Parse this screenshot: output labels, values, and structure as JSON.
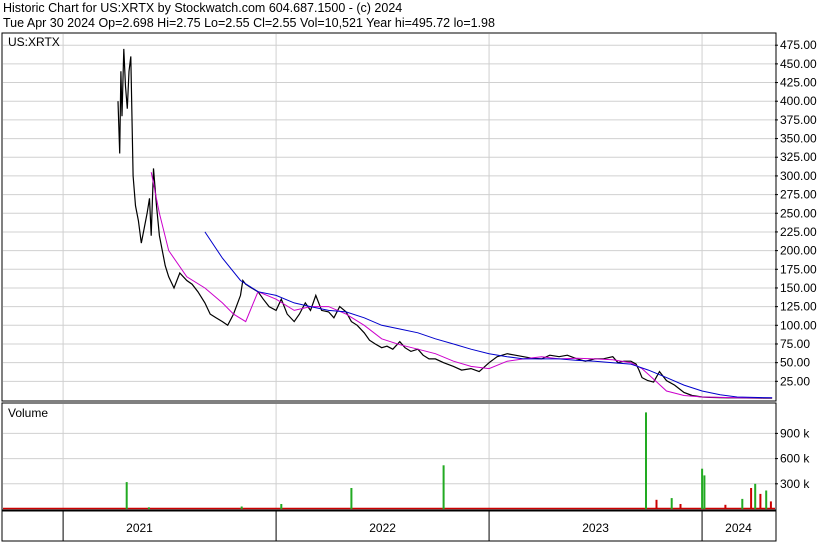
{
  "header": {
    "line1": "Historic Chart for US:XRTX by Stockwatch.com 604.687.1500 - (c) 2024",
    "line2": "Tue Apr 30 2024  Op=2.698  Hi=2.75  Lo=2.55  Cl=2.55  Vol=10,521  Year hi=495.72  lo=1.98"
  },
  "colors": {
    "price_line": "#000000",
    "ma_short": "#cc00cc",
    "ma_long": "#0000cc",
    "vol_up": "#22aa22",
    "vol_down": "#cc0000",
    "grid": "#d0d0d0",
    "border": "#000000"
  },
  "chart_data": [
    {
      "type": "line",
      "title": "US:XRTX",
      "xlabel": "",
      "ylabel": "",
      "ylim": [
        0,
        490
      ],
      "y_ticks": [
        475,
        450,
        425,
        400,
        375,
        350,
        325,
        300,
        275,
        250,
        225,
        200,
        175,
        150,
        125,
        100,
        75,
        50,
        25
      ],
      "y_tick_labels": [
        "475.00",
        "450.00",
        "425.00",
        "400.00",
        "375.00",
        "350.00",
        "325.00",
        "300.00",
        "275.00",
        "250.00",
        "225.00",
        "200.00",
        "175.00",
        "150.00",
        "125.00",
        "100.00",
        "75.00",
        "50.00",
        "25.00"
      ],
      "x_ticks": [
        "2021",
        "2022",
        "2023",
        "2024"
      ],
      "x_tick_dates": [
        "2021-01-01",
        "2022-01-01",
        "2023-01-01",
        "2024-01-01"
      ],
      "xlim": [
        "2020-09-20",
        "2024-05-05"
      ],
      "grid": true,
      "series": [
        {
          "style": "price",
          "x": [
            "2021-04-05",
            "2021-04-08",
            "2021-04-10",
            "2021-04-12",
            "2021-04-15",
            "2021-04-18",
            "2021-04-21",
            "2021-04-24",
            "2021-04-27",
            "2021-05-01",
            "2021-05-05",
            "2021-05-10",
            "2021-05-15",
            "2021-05-20",
            "2021-05-25",
            "2021-05-29",
            "2021-06-01",
            "2021-06-05",
            "2021-06-10",
            "2021-06-15",
            "2021-06-20",
            "2021-06-25",
            "2021-07-01",
            "2021-07-10",
            "2021-07-20",
            "2021-08-01",
            "2021-08-10",
            "2021-08-20",
            "2021-09-01",
            "2021-09-10",
            "2021-09-20",
            "2021-10-01",
            "2021-10-10",
            "2021-10-20",
            "2021-11-01",
            "2021-11-05",
            "2021-11-10",
            "2021-11-20",
            "2021-12-01",
            "2021-12-10",
            "2021-12-20",
            "2022-01-01",
            "2022-01-10",
            "2022-01-20",
            "2022-02-01",
            "2022-02-10",
            "2022-02-20",
            "2022-03-01",
            "2022-03-10",
            "2022-03-20",
            "2022-04-01",
            "2022-04-10",
            "2022-04-20",
            "2022-05-01",
            "2022-05-10",
            "2022-05-20",
            "2022-06-01",
            "2022-06-10",
            "2022-06-20",
            "2022-07-01",
            "2022-07-10",
            "2022-07-20",
            "2022-08-01",
            "2022-08-10",
            "2022-08-20",
            "2022-09-01",
            "2022-09-10",
            "2022-09-20",
            "2022-10-01",
            "2022-10-15",
            "2022-11-01",
            "2022-11-15",
            "2022-12-01",
            "2022-12-15",
            "2023-01-01",
            "2023-01-15",
            "2023-02-01",
            "2023-02-15",
            "2023-03-01",
            "2023-03-15",
            "2023-04-01",
            "2023-04-15",
            "2023-05-01",
            "2023-05-15",
            "2023-06-01",
            "2023-06-15",
            "2023-07-01",
            "2023-07-15",
            "2023-08-01",
            "2023-08-10",
            "2023-08-20",
            "2023-09-01",
            "2023-09-10",
            "2023-09-15",
            "2023-09-20",
            "2023-09-25",
            "2023-09-30",
            "2023-10-10",
            "2023-10-20",
            "2023-11-01",
            "2023-11-15",
            "2023-12-01",
            "2023-12-15",
            "2024-01-01",
            "2024-01-15",
            "2024-02-01",
            "2024-02-15",
            "2024-03-01",
            "2024-03-15",
            "2024-04-01",
            "2024-04-15",
            "2024-04-30"
          ],
          "values": [
            400,
            330,
            440,
            380,
            470,
            420,
            390,
            440,
            460,
            300,
            260,
            240,
            210,
            230,
            250,
            270,
            220,
            310,
            260,
            220,
            200,
            180,
            165,
            150,
            170,
            160,
            155,
            145,
            130,
            115,
            110,
            105,
            100,
            115,
            140,
            160,
            155,
            150,
            145,
            135,
            125,
            120,
            135,
            115,
            105,
            115,
            130,
            120,
            140,
            120,
            118,
            110,
            125,
            118,
            105,
            100,
            90,
            80,
            75,
            70,
            72,
            68,
            78,
            70,
            65,
            68,
            60,
            55,
            55,
            50,
            45,
            40,
            42,
            38,
            50,
            58,
            62,
            60,
            58,
            56,
            55,
            60,
            58,
            60,
            55,
            52,
            55,
            55,
            58,
            50,
            52,
            52,
            48,
            40,
            30,
            28,
            26,
            24,
            38,
            26,
            20,
            10,
            6,
            4,
            3.5,
            3.2,
            3.0,
            2.9,
            2.8,
            2.7,
            2.6,
            2.55
          ]
        },
        {
          "style": "ma_short",
          "x": [
            "2021-06-01",
            "2021-06-15",
            "2021-07-01",
            "2021-08-01",
            "2021-09-01",
            "2021-10-01",
            "2021-10-20",
            "2021-11-10",
            "2021-12-01",
            "2022-01-01",
            "2022-02-01",
            "2022-03-01",
            "2022-04-01",
            "2022-05-01",
            "2022-06-01",
            "2022-07-01",
            "2022-08-01",
            "2022-09-01",
            "2022-10-01",
            "2022-11-01",
            "2022-12-01",
            "2023-01-01",
            "2023-02-01",
            "2023-03-01",
            "2023-04-01",
            "2023-05-01",
            "2023-06-01",
            "2023-07-01",
            "2023-08-01",
            "2023-09-01",
            "2023-09-20",
            "2023-10-10",
            "2023-11-01",
            "2023-12-01",
            "2024-01-01",
            "2024-02-01",
            "2024-03-01",
            "2024-04-30"
          ],
          "values": [
            305,
            250,
            200,
            165,
            150,
            130,
            115,
            105,
            145,
            135,
            120,
            125,
            125,
            115,
            100,
            82,
            74,
            68,
            62,
            52,
            45,
            42,
            52,
            55,
            58,
            55,
            56,
            55,
            54,
            50,
            42,
            28,
            12,
            6,
            4,
            3.5,
            3,
            2.8
          ]
        },
        {
          "style": "ma_long",
          "x": [
            "2021-09-01",
            "2021-10-01",
            "2021-11-01",
            "2021-12-01",
            "2022-01-01",
            "2022-02-01",
            "2022-03-01",
            "2022-04-01",
            "2022-05-01",
            "2022-06-01",
            "2022-07-01",
            "2022-08-01",
            "2022-09-01",
            "2022-10-01",
            "2022-11-01",
            "2022-12-01",
            "2023-01-01",
            "2023-02-01",
            "2023-03-01",
            "2023-04-01",
            "2023-05-01",
            "2023-06-01",
            "2023-07-01",
            "2023-08-01",
            "2023-09-01",
            "2023-10-01",
            "2023-11-01",
            "2023-12-01",
            "2024-01-01",
            "2024-02-01",
            "2024-03-01",
            "2024-04-30"
          ],
          "values": [
            225,
            190,
            160,
            145,
            140,
            130,
            125,
            120,
            118,
            110,
            100,
            95,
            90,
            82,
            75,
            68,
            62,
            58,
            55,
            55,
            55,
            53,
            52,
            50,
            48,
            40,
            30,
            20,
            12,
            7,
            4,
            3
          ]
        }
      ]
    },
    {
      "type": "bar",
      "title": "Volume",
      "ylim": [
        0,
        1250000
      ],
      "y_ticks": [
        900000,
        600000,
        300000
      ],
      "y_tick_labels": [
        "900 k",
        "600 k",
        "300 k"
      ],
      "x": [
        "2021-04-20",
        "2021-05-28",
        "2021-11-03",
        "2022-01-10",
        "2022-05-10",
        "2022-10-15",
        "2023-09-27",
        "2023-10-15",
        "2023-11-10",
        "2023-11-25",
        "2024-01-01",
        "2024-01-05",
        "2024-02-10",
        "2024-03-10",
        "2024-03-25",
        "2024-04-01",
        "2024-04-10",
        "2024-04-20",
        "2024-04-28"
      ],
      "values": [
        320000,
        20000,
        30000,
        60000,
        250000,
        520000,
        1150000,
        110000,
        130000,
        60000,
        480000,
        400000,
        50000,
        120000,
        250000,
        300000,
        180000,
        220000,
        90000
      ],
      "colors": [
        "#22aa22",
        "#22aa22",
        "#22aa22",
        "#22aa22",
        "#22aa22",
        "#22aa22",
        "#22aa22",
        "#cc0000",
        "#22aa22",
        "#cc0000",
        "#22aa22",
        "#22aa22",
        "#cc0000",
        "#22aa22",
        "#cc0000",
        "#22aa22",
        "#cc0000",
        "#22aa22",
        "#cc0000"
      ]
    }
  ]
}
